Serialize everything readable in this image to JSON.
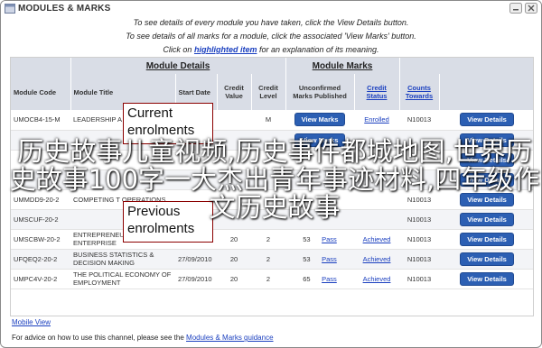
{
  "window": {
    "title": "MODULES & MARKS"
  },
  "instructions": {
    "line1": "To see details of every module you have taken, click the View Details button.",
    "line2": "To see details of all marks for a module, click the associated 'View Marks' button.",
    "line3_pre": "Click on",
    "line3_link": "highlighted item",
    "line3_post": "for an explanation of its meaning."
  },
  "groups": {
    "details": "Module Details",
    "marks": "Module Marks"
  },
  "columns": {
    "code": "Module Code",
    "title": "Module Title",
    "start": "Start Date",
    "credit_value": "Credit Value",
    "credit_level": "Credit Level",
    "unconfirmed": "Unconfirmed Marks Published",
    "credit_status": "Credit Status",
    "counts_towards": "Counts Towards"
  },
  "rows": [
    {
      "code": "UMOCB4-15-M",
      "title": "LEADERSHIP A",
      "start": "",
      "value": "",
      "level": "M",
      "marks": "View Marks",
      "status": "Enrolled",
      "towards": "N10013",
      "action": "View Details"
    },
    {
      "code": "",
      "title": "",
      "start": "",
      "value": "",
      "level": "",
      "marks": "View Marks",
      "status": "",
      "towards": "",
      "action": "View Details"
    },
    {
      "code": "",
      "title": "",
      "start": "",
      "value": "",
      "level": "",
      "marks": "",
      "status": "",
      "towards": "",
      "action": "View Details"
    },
    {
      "code": "",
      "title": "",
      "start": "",
      "value": "",
      "level": "",
      "marks": "",
      "status": "",
      "towards": "",
      "action": "View Details"
    },
    {
      "code": "UMMDD9-20-2",
      "title": "COMPETING T OPERATIONS",
      "start": "",
      "value": "",
      "level": "",
      "marks": "",
      "status": "",
      "towards": "N10013",
      "action": "View Details"
    },
    {
      "code": "UMSCUF-20-2",
      "title": "",
      "start": "",
      "value": "",
      "level": "",
      "marks": "",
      "status": "",
      "towards": "N10013",
      "action": "View Details"
    },
    {
      "code": "UMSCBW-20-2",
      "title": "ENTREPRENEURSHIP & ENTERPRISE",
      "start": "",
      "value": "20",
      "level": "2",
      "marks": "53",
      "result": "Pass",
      "status": "Achieved",
      "towards": "N10013",
      "action": "View Details"
    },
    {
      "code": "UFQEQ2-20-2",
      "title": "BUSINESS STATISTICS & DECISION MAKING",
      "start": "27/09/2010",
      "value": "20",
      "level": "2",
      "marks": "53",
      "result": "Pass",
      "status": "Achieved",
      "towards": "N10013",
      "action": "View Details"
    },
    {
      "code": "UMPC4V-20-2",
      "title": "THE POLITICAL ECONOMY OF EMPLOYMENT",
      "start": "27/09/2010",
      "value": "20",
      "level": "2",
      "marks": "65",
      "result": "Pass",
      "status": "Achieved",
      "towards": "N10013",
      "action": "View Details"
    }
  ],
  "callouts": {
    "current": "Current enrolments",
    "previous": "Previous enrolments"
  },
  "overlay_text": "历史故事儿童视频,历史事件都城地图,世界历史故事100字一大杰出青年事迹材料,四年级作文历史故事",
  "links": {
    "mobile_view": "Mobile View"
  },
  "footer": {
    "pre": "For advice on how to use this channel, please see the",
    "link": "Modules & Marks guidance"
  },
  "colors": {
    "header_bg": "#d9dde6",
    "button_blue": "#2c5fb3",
    "link_blue": "#1a3fbf",
    "callout_border": "#8b0000"
  }
}
